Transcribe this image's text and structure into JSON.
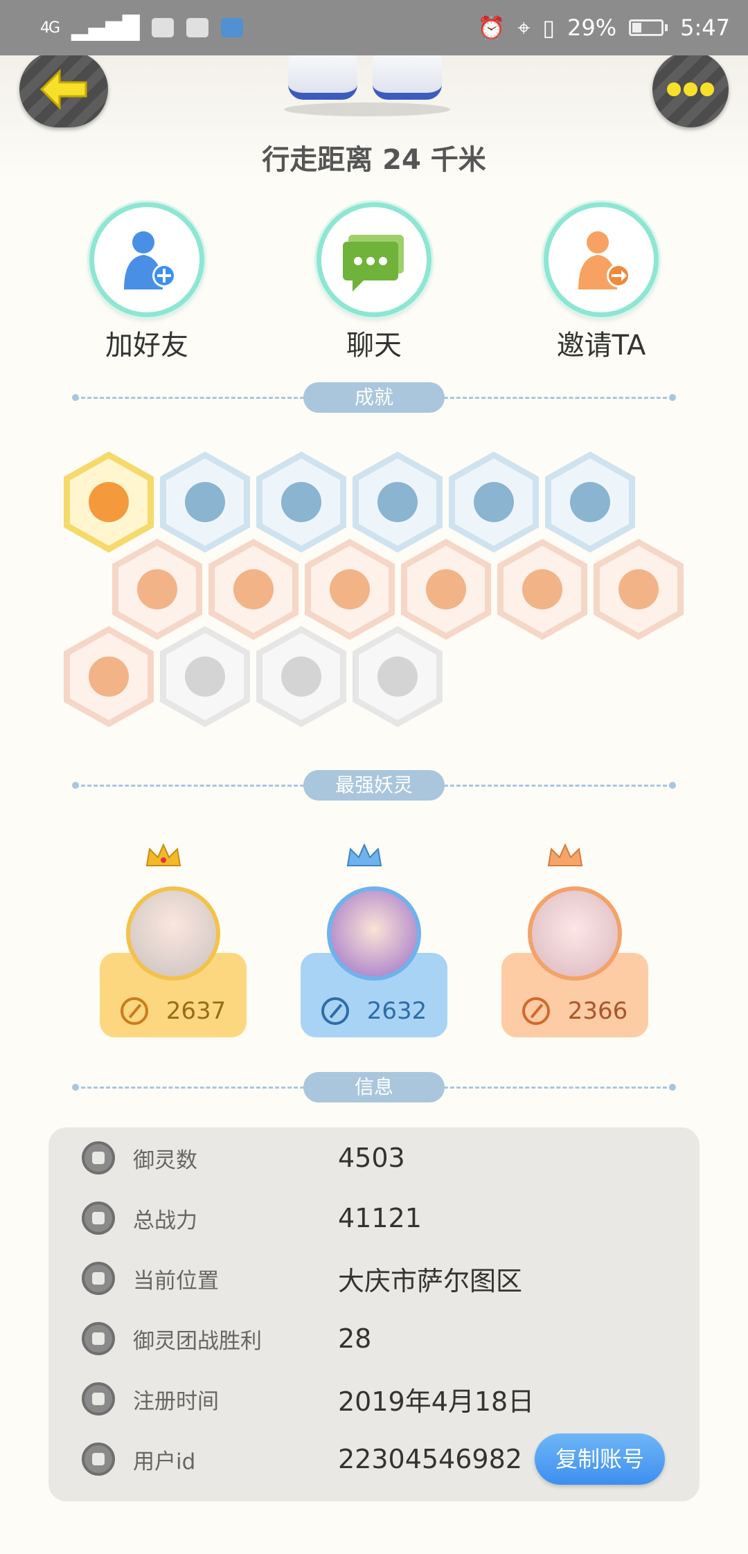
{
  "status_bar": {
    "network": "4G",
    "battery": "29%",
    "time": "5:47"
  },
  "header": {
    "walk_distance": "行走距离 24 千米"
  },
  "actions": [
    {
      "label": "加好友",
      "icon": "add-friend-icon"
    },
    {
      "label": "聊天",
      "icon": "chat-icon"
    },
    {
      "label": "邀请TA",
      "icon": "invite-icon"
    }
  ],
  "sections": {
    "achievements": "成就",
    "top_spirits": "最强妖灵",
    "info": "信息"
  },
  "achievements": [
    {
      "icon": "fox-face-badge",
      "tier": "gold"
    },
    {
      "icon": "portal-badge",
      "tier": "blue"
    },
    {
      "icon": "moon-badge",
      "tier": "blue"
    },
    {
      "icon": "yin-yang-wave-badge",
      "tier": "blue"
    },
    {
      "icon": "yin-yang-book-badge",
      "tier": "blue"
    },
    {
      "icon": "cat-silhouette-badge",
      "tier": "blue"
    },
    {
      "icon": "sneaker-badge",
      "tier": "peach"
    },
    {
      "icon": "boulder-badge",
      "tier": "peach"
    },
    {
      "icon": "crystal-badge",
      "tier": "peach"
    },
    {
      "icon": "spirit-figure-badge",
      "tier": "peach"
    },
    {
      "icon": "bear-spirit-badge",
      "tier": "peach"
    },
    {
      "icon": "koi-badge",
      "tier": "peach"
    },
    {
      "icon": "bull-spirit-badge",
      "tier": "peach"
    },
    {
      "icon": "cart-badge",
      "tier": "grey"
    },
    {
      "icon": "shield-badge",
      "tier": "grey"
    },
    {
      "icon": "wolf-book-badge",
      "tier": "grey"
    }
  ],
  "top_spirits": [
    {
      "power": "2637",
      "tier": "gold"
    },
    {
      "power": "2632",
      "tier": "blue"
    },
    {
      "power": "2366",
      "tier": "orange"
    }
  ],
  "info": [
    {
      "key": "御灵数",
      "value": "4503",
      "icon": "spirit-count-icon"
    },
    {
      "key": "总战力",
      "value": "41121",
      "icon": "sword-icon"
    },
    {
      "key": "当前位置",
      "value": "大庆市萨尔图区",
      "icon": "location-pin-icon"
    },
    {
      "key": "御灵团战胜利",
      "value": "28",
      "icon": "trophy-figure-icon"
    },
    {
      "key": "注册时间",
      "value": "2019年4月18日",
      "icon": "clock-icon"
    },
    {
      "key": "用户id",
      "value": "22304546982",
      "icon": "id-card-icon"
    }
  ],
  "copy_button": "复制账号",
  "colors": {
    "accent_blue": "#3d8ff0",
    "divider_pill": "#a9c6dc",
    "ring_teal": "#8ee6d2"
  }
}
